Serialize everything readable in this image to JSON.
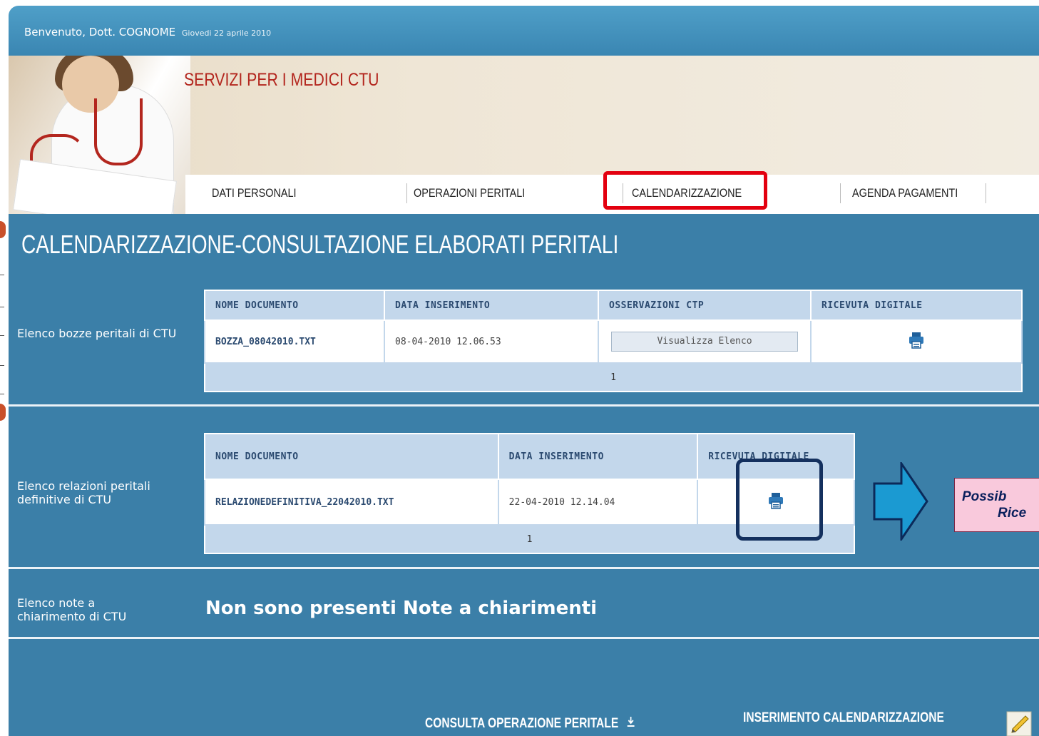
{
  "header": {
    "welcome": "Benvenuto, Dott. COGNOME",
    "date": "Giovedi 22 aprile 2010",
    "site_title": "SERVIZI PER I MEDICI CTU"
  },
  "tabs": [
    {
      "label": "DATI PERSONALI"
    },
    {
      "label": "OPERAZIONI PERITALI"
    },
    {
      "label": "CALENDARIZZAZIONE"
    },
    {
      "label": "AGENDA PAGAMENTI"
    }
  ],
  "page_title": "CALENDARIZZAZIONE-CONSULTAZIONE ELABORATI PERITALI",
  "bozze": {
    "label": "Elenco bozze peritali di CTU",
    "headers": [
      "NOME DOCUMENTO",
      "DATA INSERIMENTO",
      "OSSERVAZIONI CTP",
      "RICEVUTA DIGITALE"
    ],
    "rows": [
      {
        "name": "BOZZA_08042010.TXT",
        "date": "08-04-2010 12.06.53",
        "button": "Visualizza Elenco",
        "receipt_icon": "printer-icon"
      }
    ],
    "pager": "1"
  },
  "relazioni": {
    "label": "Elenco relazioni peritali definitive di CTU",
    "headers": [
      "NOME DOCUMENTO",
      "DATA INSERIMENTO",
      "RICEVUTA DIGITALE"
    ],
    "rows": [
      {
        "name": "RELAZIONEDEFINITIVA_22042010.TXT",
        "date": "22-04-2010 12.14.04",
        "receipt_icon": "printer-icon"
      }
    ],
    "pager": "1"
  },
  "callout": {
    "line1": "Possib",
    "line2": "Rice"
  },
  "note": {
    "label": "Elenco note a chiarimento di CTU",
    "message": "Non sono presenti Note a chiarimenti"
  },
  "footer": {
    "consulta": "CONSULTA OPERAZIONE PERITALE",
    "inserimento": "INSERIMENTO CALENDARIZZAZIONE"
  },
  "colors": {
    "accent_blue": "#3b7fa8",
    "highlight_red": "#e3000f",
    "focus_navy": "#14305e",
    "callout_pink": "#f9c9dc"
  }
}
